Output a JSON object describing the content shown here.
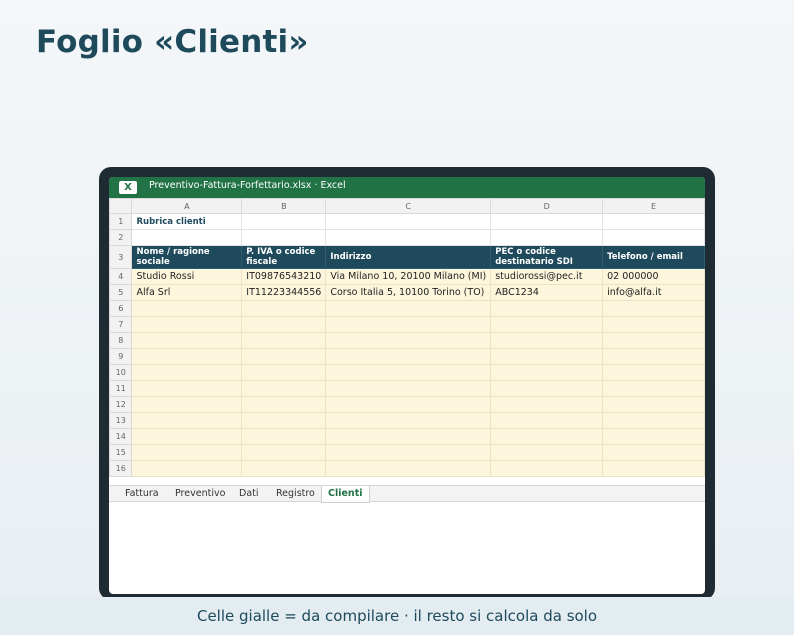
{
  "page": {
    "title": "Foglio «Clienti»"
  },
  "window": {
    "app_icon": "X",
    "title": "Preventivo-Fattura-Forfettario.xlsx · Excel"
  },
  "sheet": {
    "columns": [
      "A",
      "B",
      "C",
      "D",
      "E"
    ],
    "row_numbers": [
      "1",
      "2",
      "3",
      "4",
      "5",
      "6",
      "7",
      "8",
      "9",
      "10",
      "11",
      "12",
      "13",
      "14",
      "15",
      "16"
    ],
    "caption": "Rubrica clienti",
    "headers": [
      "Nome / ragione sociale",
      "P. IVA o codice fiscale",
      "Indirizzo",
      "PEC o codice destinatario SDI",
      "Telefono / email"
    ],
    "rows": [
      [
        "Studio Rossi",
        "IT09876543210",
        "Via Milano 10, 20100 Milano (MI)",
        "studiorossi@pec.it",
        "02 000000"
      ],
      [
        "Alfa Srl",
        "IT11223344556",
        "Corso Italia 5, 10100 Torino (TO)",
        "ABC1234",
        "info@alfa.it"
      ]
    ]
  },
  "tabs": [
    "Fattura",
    "Preventivo",
    "Dati",
    "Registro",
    "Clienti"
  ],
  "active_tab": "Clienti",
  "footer": {
    "note": "Celle gialle = da compilare · il resto si calcola da solo"
  },
  "colors": {
    "excel_green": "#217346",
    "header_teal": "#1e4a5c",
    "input_yellow": "#fdf6dc"
  }
}
